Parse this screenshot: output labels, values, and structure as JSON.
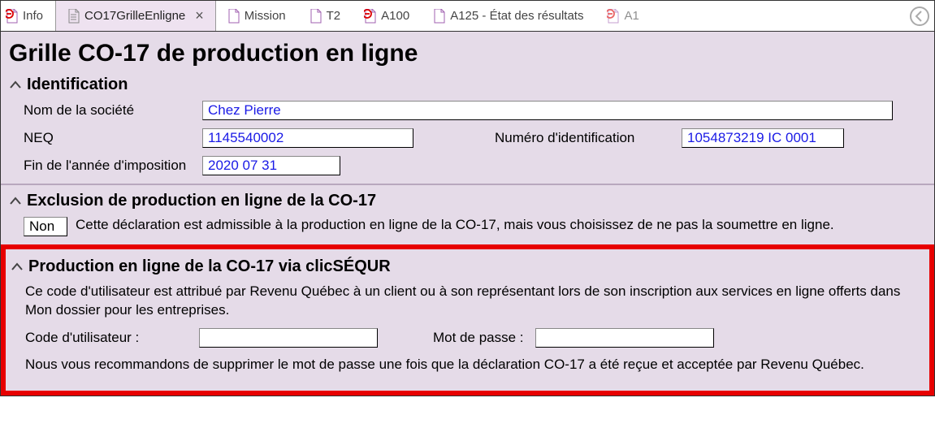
{
  "tabs": {
    "t0": "Info",
    "t1": "CO17GrilleEnligne",
    "t2": "Mission",
    "t3": "T2",
    "t4": "A100",
    "t5": "A125 - État des résultats",
    "t6": "A1"
  },
  "title": "Grille CO-17 de production en ligne",
  "sections": {
    "ident": {
      "heading": "Identification",
      "company_label": "Nom de la société",
      "company_value": "Chez Pierre",
      "neq_label": "NEQ",
      "neq_value": "1145540002",
      "numid_label": "Numéro d'identification",
      "numid_value": "1054873219 IC 0001",
      "fye_label": "Fin de l'année d'imposition",
      "fye_value": "2020 07 31"
    },
    "excl": {
      "heading": "Exclusion de production en ligne de la CO-17",
      "value": "Non",
      "text": "Cette déclaration est admissible à la production en ligne de la CO-17, mais vous choisissez de ne pas la soumettre en ligne."
    },
    "clic": {
      "heading": "Production en ligne de la CO-17 via clicSÉQUR",
      "desc": "Ce code d'utilisateur est attribué par Revenu Québec à un client ou à son représentant lors de son inscription aux services en ligne offerts dans Mon dossier pour les entreprises.",
      "user_label": "Code d'utilisateur :",
      "pass_label": "Mot de passe :",
      "note": "Nous vous recommandons de supprimer le mot de passe une fois que la déclaration CO-17 a été reçue et acceptée par Revenu Québec."
    }
  }
}
